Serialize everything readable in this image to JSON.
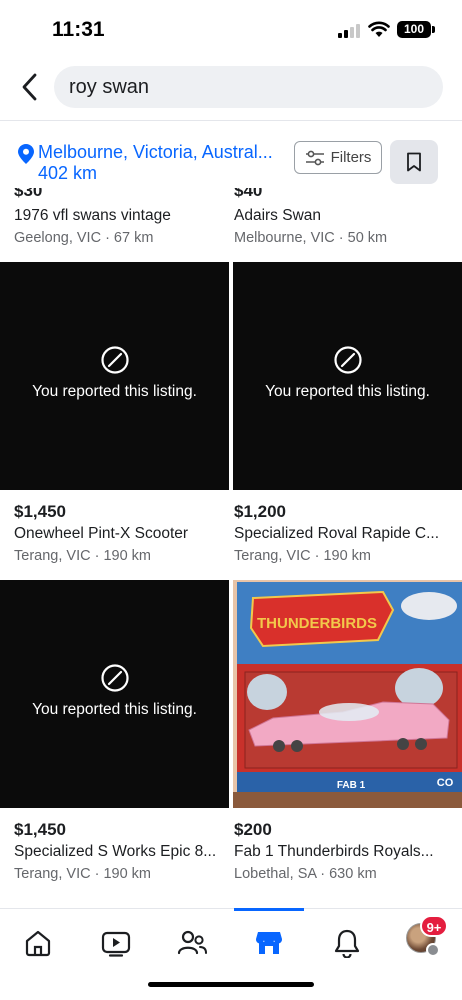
{
  "status_bar": {
    "time": "11:31",
    "battery": "100"
  },
  "search": {
    "query": "roy swan"
  },
  "location": {
    "name": "Melbourne, Victoria, Austral...",
    "radius": "402 km"
  },
  "filters": {
    "label": "Filters"
  },
  "reported_text": "You reported this listing.",
  "listings": [
    {
      "price": "$30",
      "title": "1976 vfl swans vintage",
      "meta": "Geelong, VIC · 67 km",
      "reported": false
    },
    {
      "price": "$40",
      "title": "Adairs Swan",
      "meta": "Melbourne, VIC · 50 km",
      "reported": false
    },
    {
      "price": "$1,450",
      "title": "Onewheel Pint-X Scooter",
      "meta": "Terang, VIC · 190 km",
      "reported": true
    },
    {
      "price": "$1,200",
      "title": "Specialized Roval Rapide C...",
      "meta": "Terang, VIC · 190 km",
      "reported": true
    },
    {
      "price": "$1,450",
      "title": "Specialized S Works Epic 8...",
      "meta": "Terang, VIC · 190 km",
      "reported": true
    },
    {
      "price": "$200",
      "title": "Fab 1  Thunderbirds Royals...",
      "meta": "Lobethal, SA · 630 km",
      "reported": false,
      "image_text": {
        "logo": "THUNDERBIRDS",
        "model": "FAB 1",
        "brand": "CO"
      }
    }
  ],
  "bottom_nav": {
    "items": [
      "home-icon",
      "video-icon",
      "friends-icon",
      "marketplace-icon",
      "bell-icon",
      "profile-avatar"
    ],
    "active": "marketplace-icon",
    "badge": "9+"
  },
  "colors": {
    "accent": "#0866ff",
    "badge": "#e41e3f"
  }
}
